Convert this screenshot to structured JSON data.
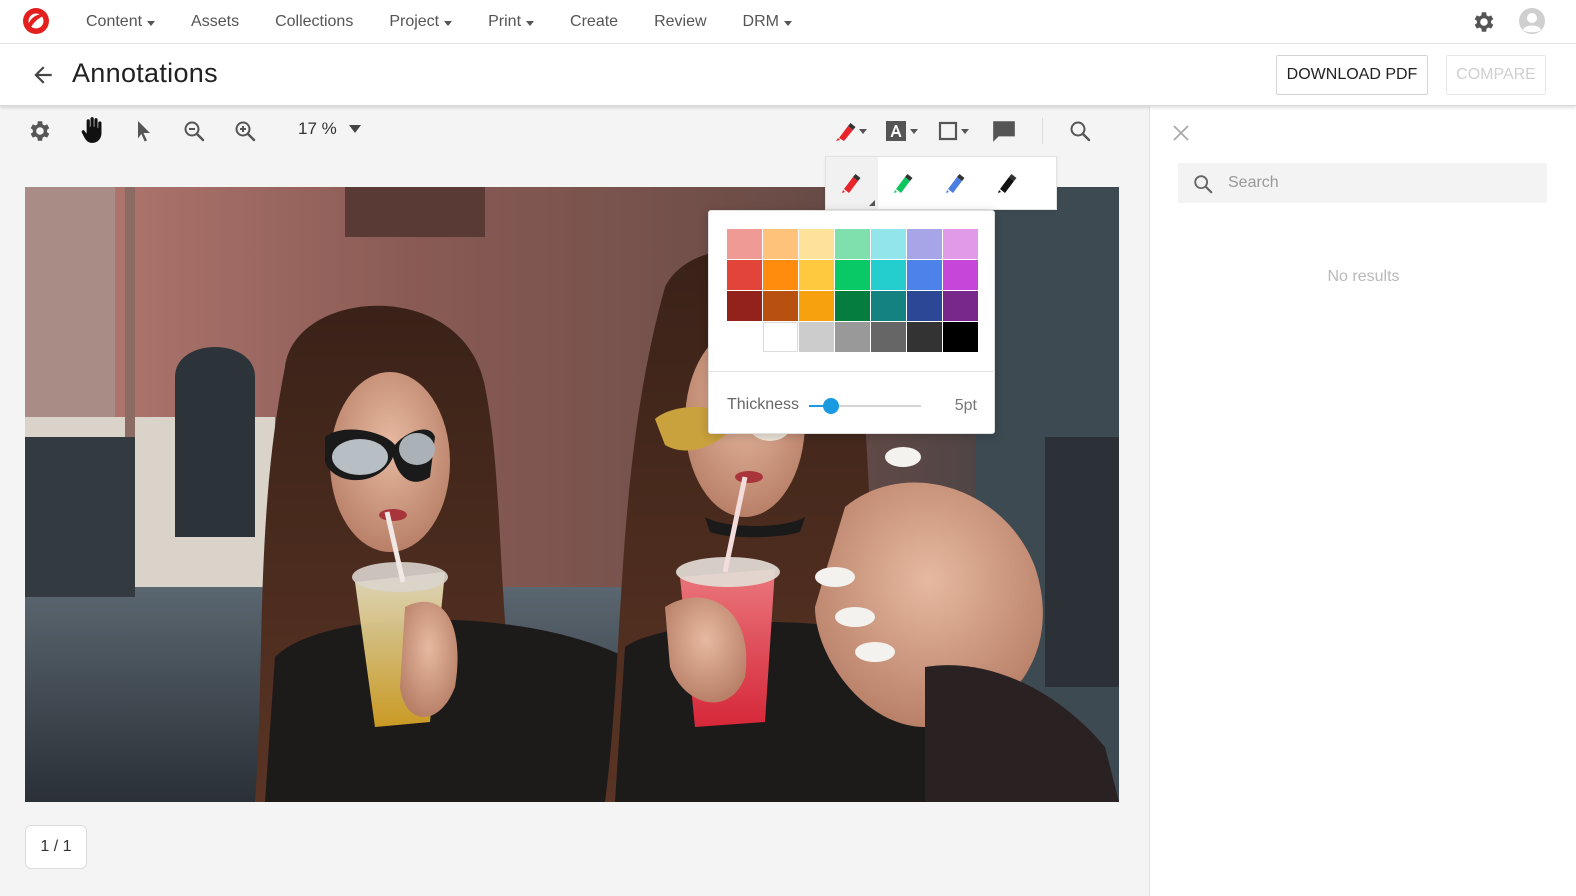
{
  "nav": {
    "items": [
      {
        "label": "Content",
        "dropdown": true
      },
      {
        "label": "Assets",
        "dropdown": false
      },
      {
        "label": "Collections",
        "dropdown": false
      },
      {
        "label": "Project",
        "dropdown": true
      },
      {
        "label": "Print",
        "dropdown": true
      },
      {
        "label": "Create",
        "dropdown": false
      },
      {
        "label": "Review",
        "dropdown": false
      },
      {
        "label": "DRM",
        "dropdown": true
      }
    ],
    "right_icons": [
      "gear-icon",
      "avatar-icon"
    ],
    "logo_color": "#e4201f"
  },
  "header": {
    "title": "Annotations",
    "download_label": "DOWNLOAD PDF",
    "compare_label": "COMPARE",
    "compare_disabled": true
  },
  "toolbar": {
    "zoom_label": "17 %",
    "left_tools": [
      "settings-icon",
      "pan-hand-icon",
      "select-pointer-icon",
      "zoom-out-icon",
      "zoom-in-icon"
    ],
    "right_tools": [
      "pen-icon",
      "text-icon",
      "rectangle-icon",
      "comment-icon",
      "search-icon"
    ],
    "active_pen_color": "#e8242b"
  },
  "pen_flyout": {
    "pens": [
      {
        "name": "red",
        "color": "#e8242b",
        "active": true
      },
      {
        "name": "green",
        "color": "#10c560"
      },
      {
        "name": "blue",
        "color": "#4a7ee0"
      },
      {
        "name": "black",
        "color": "#111111"
      }
    ]
  },
  "palette": {
    "swatches": [
      "#ef9a94",
      "#ffc27a",
      "#ffe299",
      "#7fe0ad",
      "#92e5ea",
      "#a8a4e8",
      "#e19ae8",
      "#e2443a",
      "#ff8c0d",
      "#ffc93f",
      "#08c965",
      "#24cecf",
      "#4d82ea",
      "#c646d9",
      "#93221c",
      "#b8500f",
      "#f7a10e",
      "#047d3f",
      "#158282",
      "#2c4795",
      "#77288a",
      "",
      "#ffffff",
      "#cccccc",
      "#999999",
      "#666666",
      "#333333",
      "#000000"
    ],
    "thickness_label": "Thickness",
    "thickness_value": "5pt",
    "thickness_fraction": 0.2,
    "slider_color": "#1a9ae0"
  },
  "page_counter": "1 / 1",
  "side_panel": {
    "search_placeholder": "Search",
    "no_results": "No results"
  }
}
